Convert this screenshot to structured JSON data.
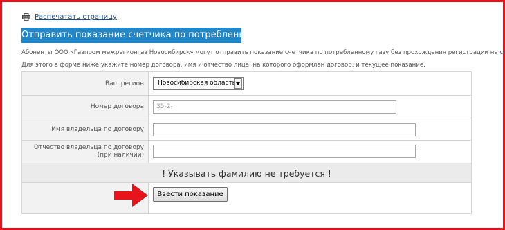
{
  "print": {
    "label": "Распечатать страницу",
    "icon": "printer-icon"
  },
  "header_button": "Отправить показание счетчика по потребленному газу",
  "intro": {
    "line1": "Абоненты ООО «Газпром межрегионгаз Новосибирск» могут отправить показание счетчика по потребленному газу без прохождения регистрации на сайте.",
    "line2": "Для этого в форме ниже укажите номер договора, имя и отчество лица, на которого оформлен договор, и текущее показание."
  },
  "form": {
    "region_label": "Ваш регион",
    "region_value": "Новосибирская область",
    "contract_label": "Номер договора",
    "contract_placeholder": "35-2-",
    "first_name_label": "Имя владельца по договору",
    "first_name_value": "",
    "patronymic_label_line1": "Отчество владельца по договору",
    "patronymic_label_line2": "(при наличии)",
    "patronymic_value": "",
    "warning": "! Указывать фамилию не требуется !",
    "submit_label": "Ввести показание"
  },
  "colors": {
    "frame_border": "#e8141b",
    "header_button_bg": "#2187c9",
    "arrow": "#e8141b"
  }
}
